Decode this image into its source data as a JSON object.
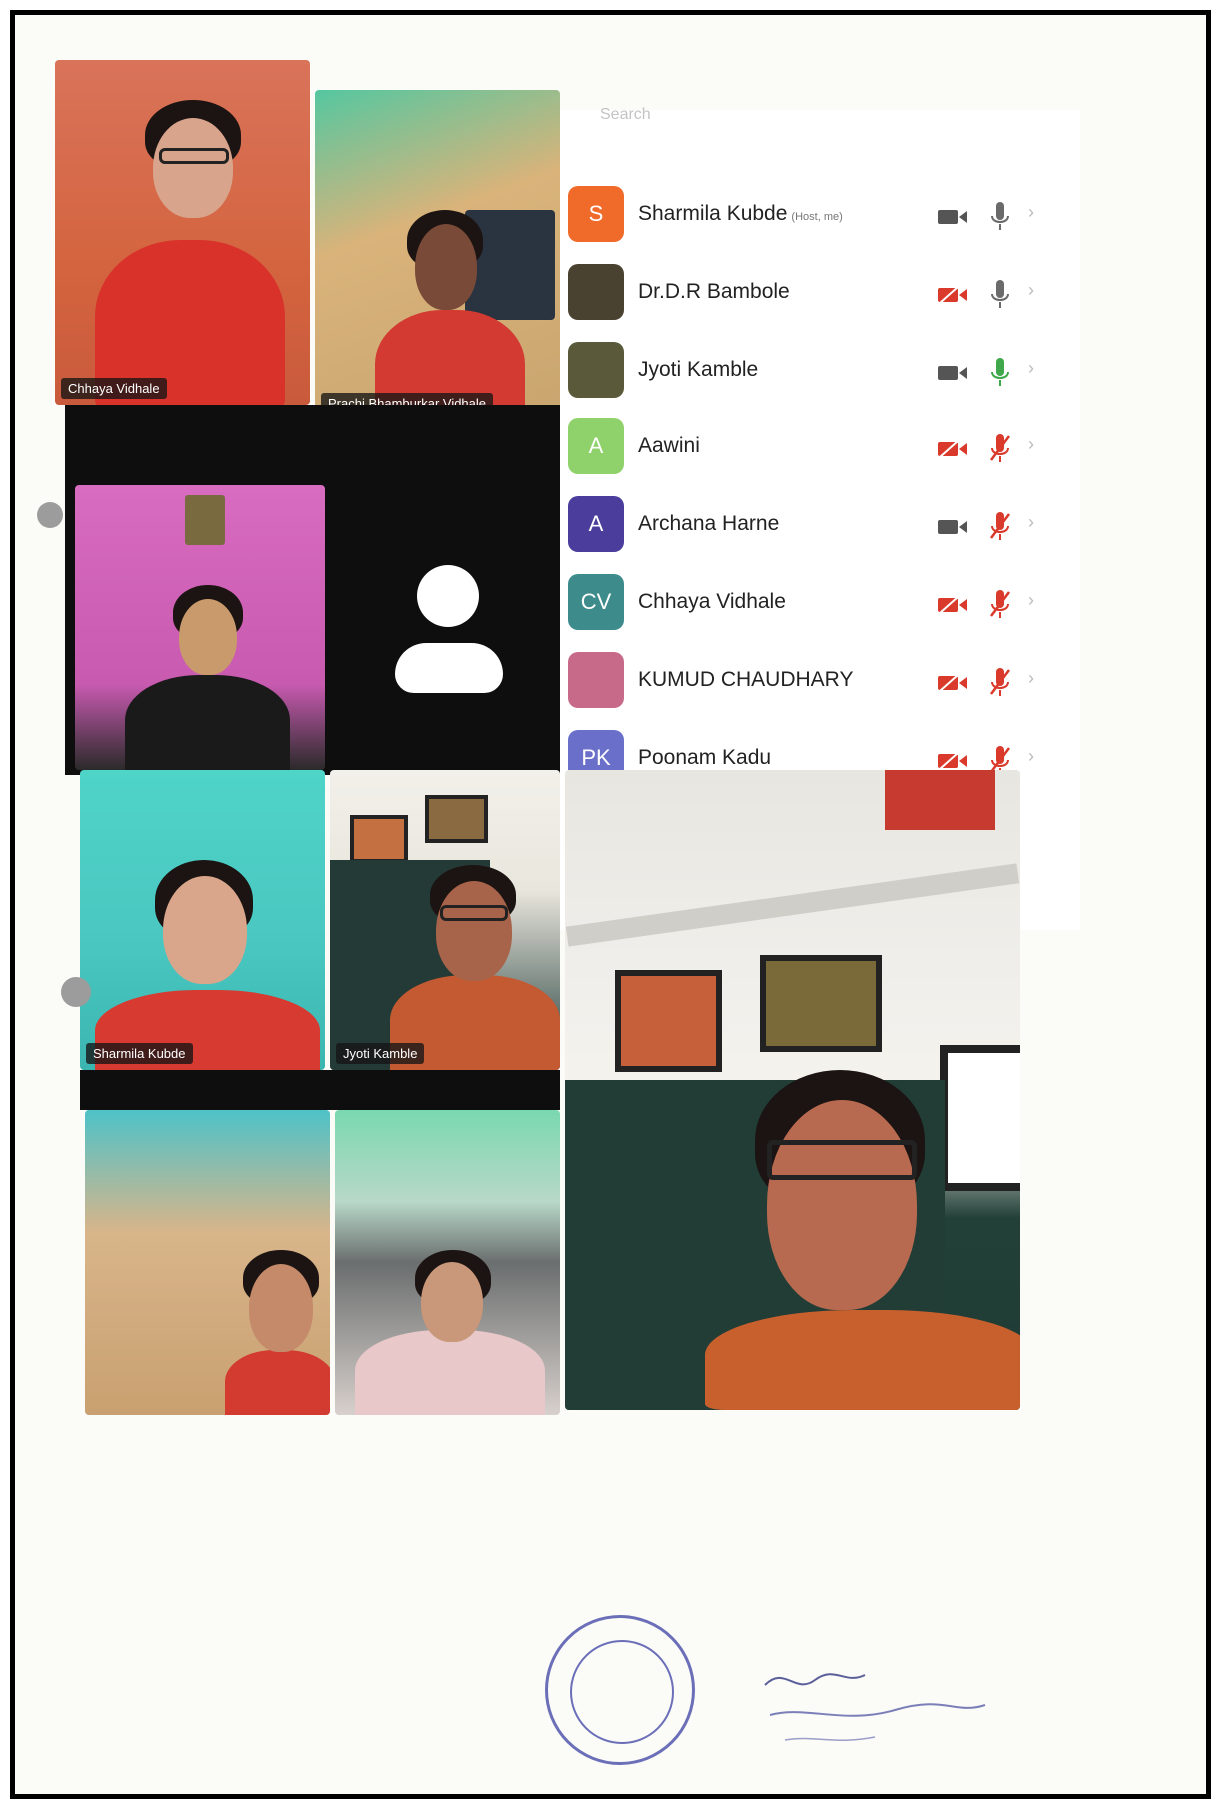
{
  "participants_panel": {
    "search_placeholder": "Search",
    "participants": [
      {
        "name": "Sharmila Kubde",
        "role": "(Host, me)",
        "initials": "S",
        "avatar_color": "#f06a2a",
        "video_on": true,
        "mic_on": true,
        "speaking": false
      },
      {
        "name": "Dr.D.R Bambole",
        "role": "",
        "initials": "",
        "avatar_color": "#4a4230",
        "video_on": false,
        "mic_on": true,
        "speaking": false
      },
      {
        "name": "Jyoti Kamble",
        "role": "",
        "initials": "",
        "avatar_color": "#5a5a3a",
        "video_on": true,
        "mic_on": true,
        "speaking": true
      },
      {
        "name": "Aawini",
        "role": "",
        "initials": "A",
        "avatar_color": "#8fd16a",
        "video_on": false,
        "mic_on": false,
        "speaking": false
      },
      {
        "name": "Archana Harne",
        "role": "",
        "initials": "A",
        "avatar_color": "#4a3d9c",
        "video_on": true,
        "mic_on": false,
        "speaking": false
      },
      {
        "name": "Chhaya Vidhale",
        "role": "",
        "initials": "CV",
        "avatar_color": "#3e8b8b",
        "video_on": false,
        "mic_on": false,
        "speaking": false
      },
      {
        "name": "KUMUD CHAUDHARY",
        "role": "",
        "initials": "",
        "avatar_color": "#c76a8a",
        "video_on": false,
        "mic_on": false,
        "speaking": false
      },
      {
        "name": "Poonam Kadu",
        "role": "",
        "initials": "PK",
        "avatar_color": "#6a6fc9",
        "video_on": false,
        "mic_on": false,
        "speaking": false
      }
    ]
  },
  "video_tiles": {
    "t1": "Chhaya Vidhale",
    "t2": "Prachi Bhamburkar Vidhale",
    "t3": "Sharmila Kubde",
    "t4": "Jyoti Kamble"
  },
  "colors": {
    "video_off_icon": "#d93a2b",
    "video_on_icon": "#555555",
    "mic_on_icon": "#6a6a6a",
    "mic_speaking_icon": "#3ea84a",
    "mic_muted_icon": "#d93a2b"
  }
}
